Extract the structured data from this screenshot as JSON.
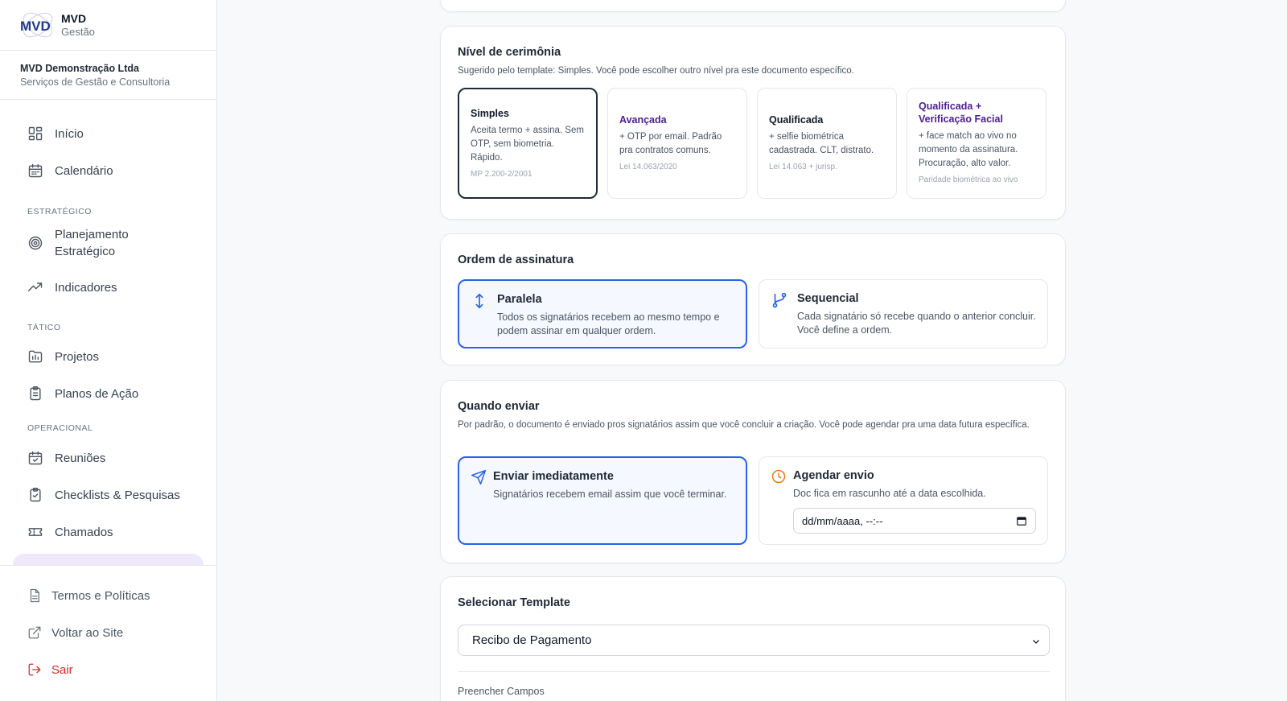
{
  "brand": {
    "logo_text": "MVD",
    "name": "MVD",
    "subtitle": "Gestão"
  },
  "org": {
    "name": "MVD Demonstração Ltda",
    "subtitle": "Serviços de Gestão e Consultoria"
  },
  "nav": {
    "inicio": "Início",
    "calendario": "Calendário",
    "section_estrategico": "ESTRATÉGICO",
    "planejamento": "Planejamento Estratégico",
    "indicadores": "Indicadores",
    "section_tatico": "TÁTICO",
    "projetos": "Projetos",
    "planos": "Planos de Ação",
    "section_operacional": "OPERACIONAL",
    "reunioes": "Reuniões",
    "checklists": "Checklists & Pesquisas",
    "chamados": "Chamados"
  },
  "bottom": {
    "termos": "Termos e Políticas",
    "voltar": "Voltar ao Site",
    "sair": "Sair"
  },
  "ceremony": {
    "title": "Nível de cerimônia",
    "description": "Sugerido pelo template: Simples. Você pode escolher outro nível pra este documento específico.",
    "levels": [
      {
        "title": "Simples",
        "desc": "Aceita termo + assina. Sem OTP, sem biometria. Rápido.",
        "law": "MP 2.200-2/2001"
      },
      {
        "title": "Avançada",
        "desc": "+ OTP por email. Padrão pra contratos comuns.",
        "law": "Lei 14.063/2020"
      },
      {
        "title": "Qualificada",
        "desc": "+ selfie biométrica cadastrada. CLT, distrato.",
        "law": "Lei 14.063 + jurisp."
      },
      {
        "title": "Qualificada + Verificação Facial",
        "desc": "+ face match ao vivo no momento da assinatura. Procuração, alto valor.",
        "law": "Paridade biométrica ao vivo"
      }
    ]
  },
  "order": {
    "title": "Ordem de assinatura",
    "parallel": {
      "title": "Paralela",
      "desc": "Todos os signatários recebem ao mesmo tempo e podem assinar em qualquer ordem."
    },
    "sequential": {
      "title": "Sequencial",
      "desc": "Cada signatário só recebe quando o anterior concluir. Você define a ordem."
    }
  },
  "send": {
    "title": "Quando enviar",
    "description": "Por padrão, o documento é enviado pros signatários assim que você concluir a criação. Você pode agendar pra uma data futura específica.",
    "now": {
      "title": "Enviar imediatamente",
      "desc": "Signatários recebem email assim que você terminar."
    },
    "schedule": {
      "title": "Agendar envio",
      "desc": "Doc fica em rascunho até a data escolhida.",
      "input_placeholder": "dd/mm/aaaa, --:--"
    }
  },
  "template": {
    "title": "Selecionar Template",
    "selected": "Recibo de Pagamento",
    "fields_label": "Preencher Campos"
  },
  "colors": {
    "accent_blue": "#2563eb",
    "accent_purple": "#4c1d95",
    "danger": "#dc2626",
    "orange": "#ea7a1b"
  }
}
